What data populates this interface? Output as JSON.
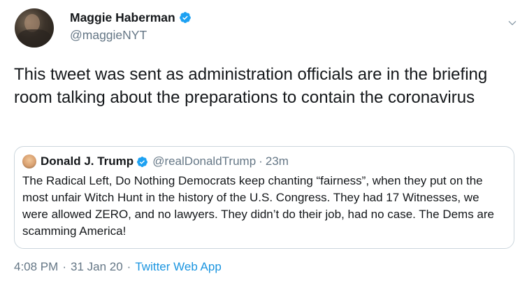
{
  "author": {
    "name": "Maggie Haberman",
    "handle": "@maggieNYT"
  },
  "tweet": {
    "text": "This tweet was sent as administration officials are in the briefing room talking about the preparations to contain the coronavirus"
  },
  "quoted_tweet": {
    "name": "Donald J. Trump",
    "handle": "@realDonaldTrump",
    "separator": "·",
    "time": "23m",
    "text": "The Radical Left, Do Nothing Democrats keep chanting “fairness”, when they put on the most unfair Witch Hunt in the history of the U.S. Congress. They had 17 Witnesses, we were allowed ZERO, and no lawyers. They didn’t do their job, had no case. The Dems are scamming America!"
  },
  "meta": {
    "time": "4:08 PM",
    "separator": "·",
    "date": "31 Jan 20",
    "source": "Twitter Web App"
  },
  "colors": {
    "verified_blue": "#1da1f2",
    "secondary_text": "#657786",
    "link_blue": "#1b95e0",
    "border": "#ccd6dd"
  },
  "icons": {
    "verified": "verified-badge-icon",
    "menu": "chevron-down-icon"
  }
}
